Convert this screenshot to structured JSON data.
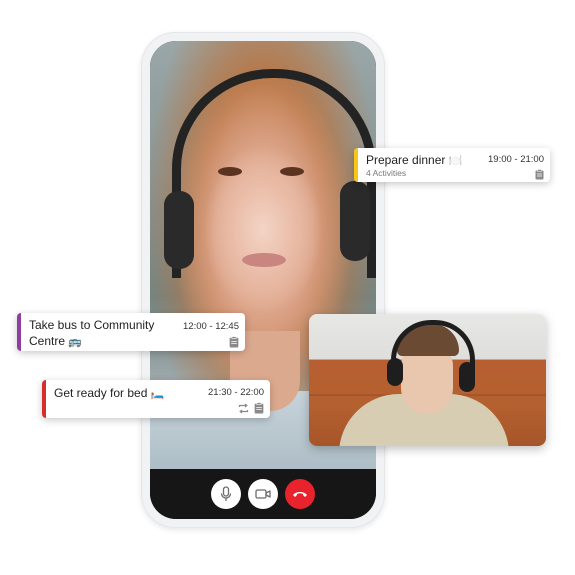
{
  "call": {
    "controls": {
      "mic_icon": "microphone-icon",
      "camera_icon": "video-camera-icon",
      "end_call_icon": "phone-hangup-icon",
      "end_call_color": "#e8232e"
    }
  },
  "cards": [
    {
      "title": "Prepare dinner",
      "emoji": "🍽️",
      "time": "19:00 - 21:00",
      "subtitle": "4 Activities",
      "accent": "#f5c518",
      "icons": [
        "clipboard-icon"
      ]
    },
    {
      "title": "Take bus to Community Centre",
      "emoji": "🚌",
      "time": "12:00 - 12:45",
      "accent": "#8e3ea0",
      "icons": [
        "clipboard-icon"
      ]
    },
    {
      "title": "Get ready for bed",
      "emoji": "🛏️",
      "time": "21:30 - 22:00",
      "accent": "#d32f2f",
      "icons": [
        "repeat-icon",
        "clipboard-icon"
      ]
    }
  ]
}
